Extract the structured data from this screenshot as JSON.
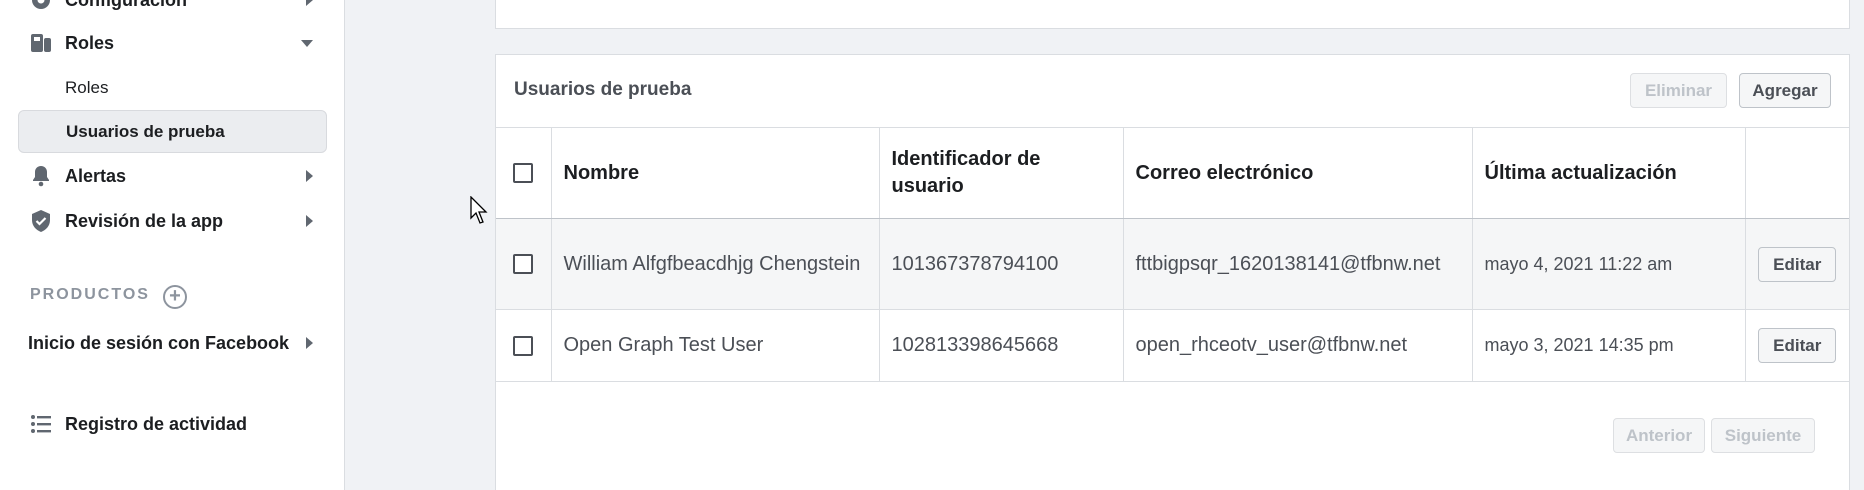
{
  "sidebar": {
    "partial_top": "Configuración",
    "roles": "Roles",
    "roles_sub": "Roles",
    "test_users_sub": "Usuarios de prueba",
    "alerts": "Alertas",
    "app_review": "Revisión de la app",
    "products_heading": "PRODUCTOS",
    "product_facebook_login": "Inicio de sesión con Facebook",
    "activity_log": "Registro de actividad"
  },
  "panel": {
    "title": "Usuarios de prueba",
    "delete_label": "Eliminar",
    "add_label": "Agregar",
    "prev_label": "Anterior",
    "next_label": "Siguiente"
  },
  "table": {
    "headers": {
      "name": "Nombre",
      "user_id": "Identificador de usuario",
      "email": "Correo electrónico",
      "updated": "Última actualización"
    },
    "rows": [
      {
        "name": "William Alfgfbeacdhjg Chengstein",
        "id": "101367378794100",
        "email": "fttbigpsqr_1620138141@tfbnw.net",
        "updated": "mayo 4, 2021 11:22 am",
        "action": "Editar"
      },
      {
        "name": "Open Graph Test User",
        "id": "102813398645668",
        "email": "open_rhceotv_user@tfbnw.net",
        "updated": "mayo 3, 2021 14:35 pm",
        "action": "Editar"
      }
    ]
  },
  "colors": {
    "sidebar_active_bg": "#ebedf0",
    "page_bg": "#f0f2f5",
    "disabled_text": "#bec3c9"
  }
}
